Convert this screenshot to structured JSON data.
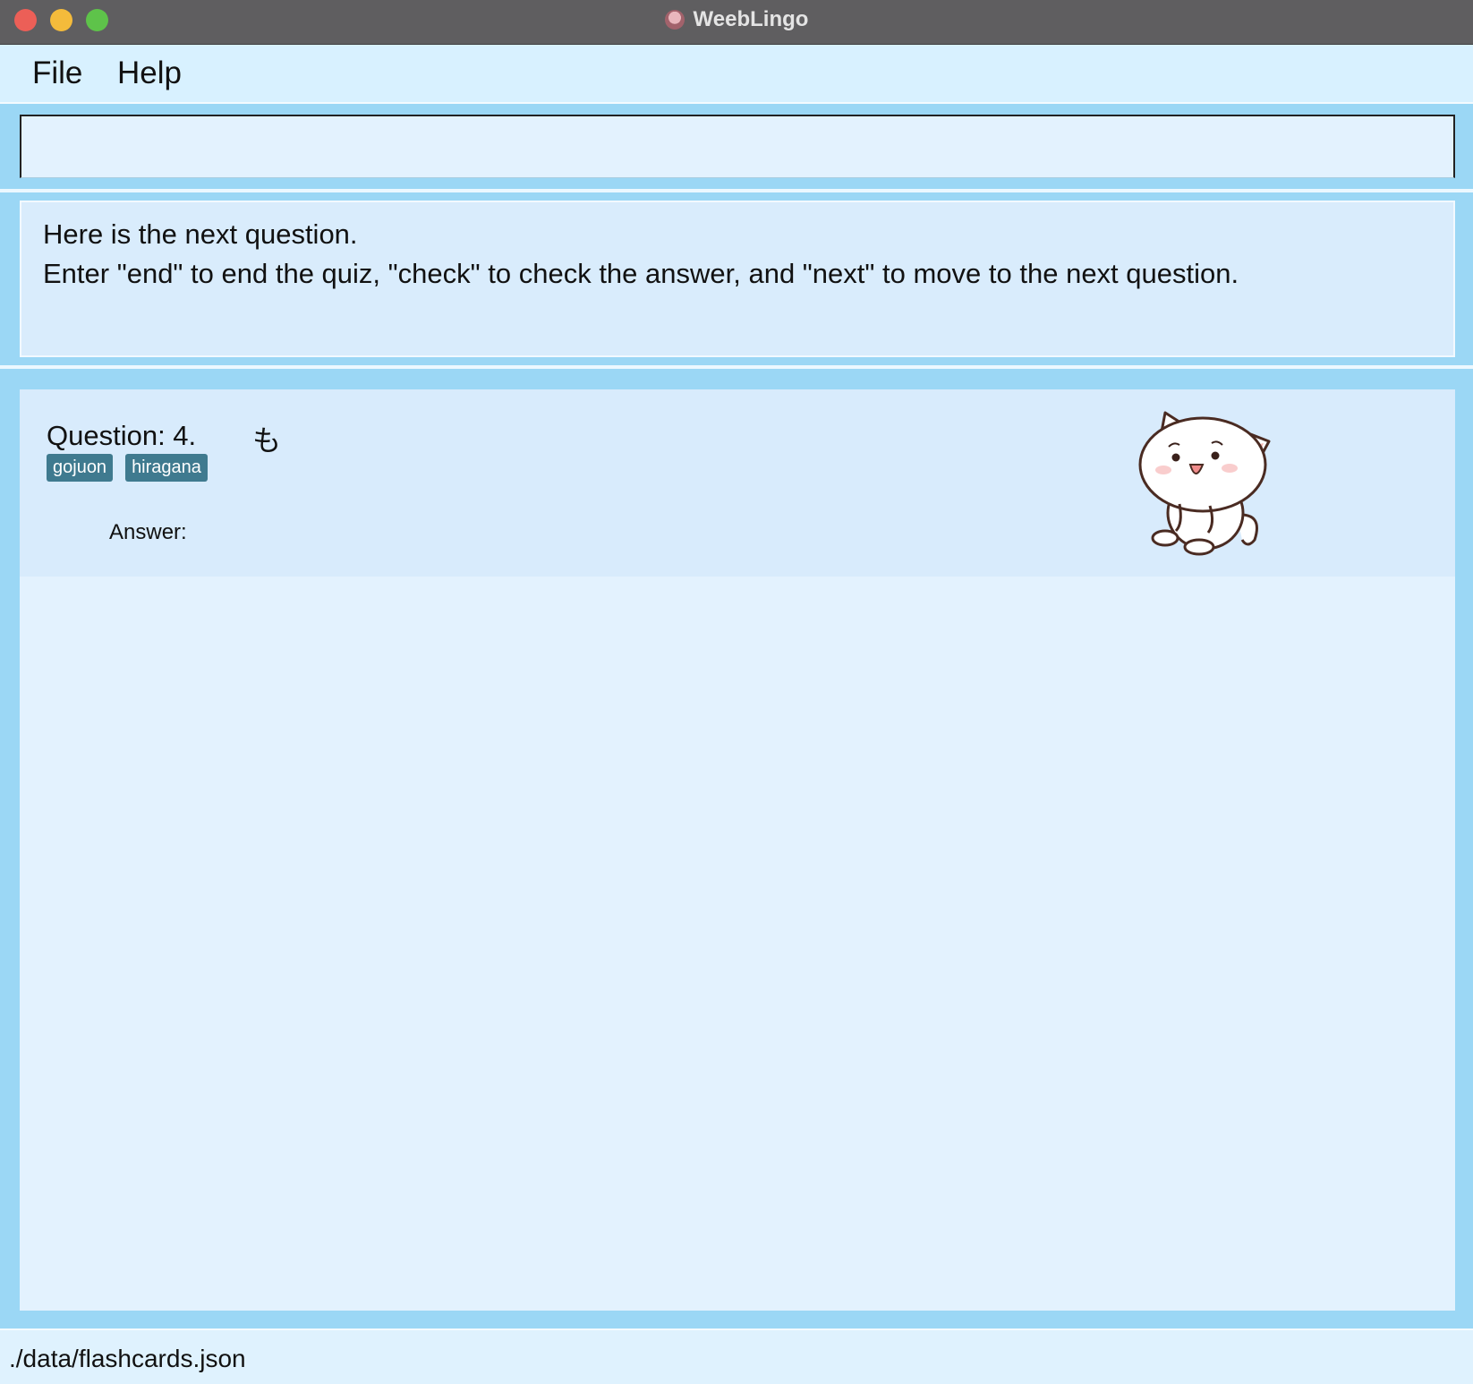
{
  "window": {
    "title": "WeebLingo"
  },
  "menu": {
    "file": "File",
    "help": "Help"
  },
  "command": {
    "value": "",
    "placeholder": ""
  },
  "result": {
    "lines": [
      "Here is the next question.",
      "Enter \"end\" to end the quiz, \"check\" to check the answer, and \"next\" to move to the next question."
    ]
  },
  "card": {
    "question_label": "Question: 4.",
    "question_char": "も",
    "tags": [
      "gojuon",
      "hiragana"
    ],
    "answer_label": "Answer:",
    "mascot_icon": "white-cat-mascot"
  },
  "status": {
    "path": "./data/flashcards.json"
  },
  "colors": {
    "titlebar": "#5f5e60",
    "menubar": "#d8f1ff",
    "accent_blue": "#9bd7f5",
    "panel": "#e3f2fe",
    "tag": "#3f7a8f"
  }
}
